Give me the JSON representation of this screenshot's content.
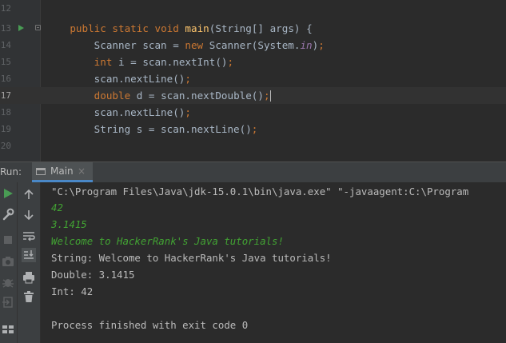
{
  "editor": {
    "lines": [
      {
        "number": "12",
        "text": ""
      },
      {
        "number": "13",
        "text": "    public static void main(String[] args) {"
      },
      {
        "number": "14",
        "text": "        Scanner scan = new Scanner(System.in);"
      },
      {
        "number": "15",
        "text": "        int i = scan.nextInt();"
      },
      {
        "number": "16",
        "text": "        scan.nextLine();"
      },
      {
        "number": "17",
        "text": "        double d = scan.nextDouble();"
      },
      {
        "number": "18",
        "text": "        scan.nextLine();"
      },
      {
        "number": "19",
        "text": "        String s = scan.nextLine();"
      },
      {
        "number": "20",
        "text": ""
      }
    ],
    "current_line": "17"
  },
  "run_panel": {
    "label": "Run:",
    "tab_label": "Main",
    "tab_close": "×",
    "toolbar_left_icons": [
      "rerun-icon",
      "wrench-icon",
      "stop-icon",
      "camera-icon",
      "debug-icon",
      "exit-icon",
      "layout-icon"
    ],
    "toolbar_right_icons": [
      "arrow-up-icon",
      "arrow-down-icon",
      "soft-wrap-icon",
      "scroll-to-end-icon",
      "print-icon",
      "trash-icon"
    ]
  },
  "console": {
    "lines": [
      {
        "text": "\"C:\\Program Files\\Java\\jdk-15.0.1\\bin\\java.exe\" \"-javaagent:C:\\Program",
        "type": "cmd"
      },
      {
        "text": "42",
        "type": "input"
      },
      {
        "text": "3.1415",
        "type": "input"
      },
      {
        "text": "Welcome to HackerRank's Java tutorials!",
        "type": "input"
      },
      {
        "text": "String: Welcome to HackerRank's Java tutorials!",
        "type": "output"
      },
      {
        "text": "Double: 3.1415",
        "type": "output"
      },
      {
        "text": "Int: 42",
        "type": "output"
      },
      {
        "text": "",
        "type": "output"
      },
      {
        "text": "Process finished with exit code 0",
        "type": "output"
      }
    ]
  },
  "colors": {
    "keyword": "#cc7832",
    "method": "#ffc66d",
    "field": "#9876aa",
    "default_text": "#a9b7c6",
    "user_input": "#42a333",
    "accent_tab": "#4a88c7",
    "run_green": "#499c54"
  }
}
